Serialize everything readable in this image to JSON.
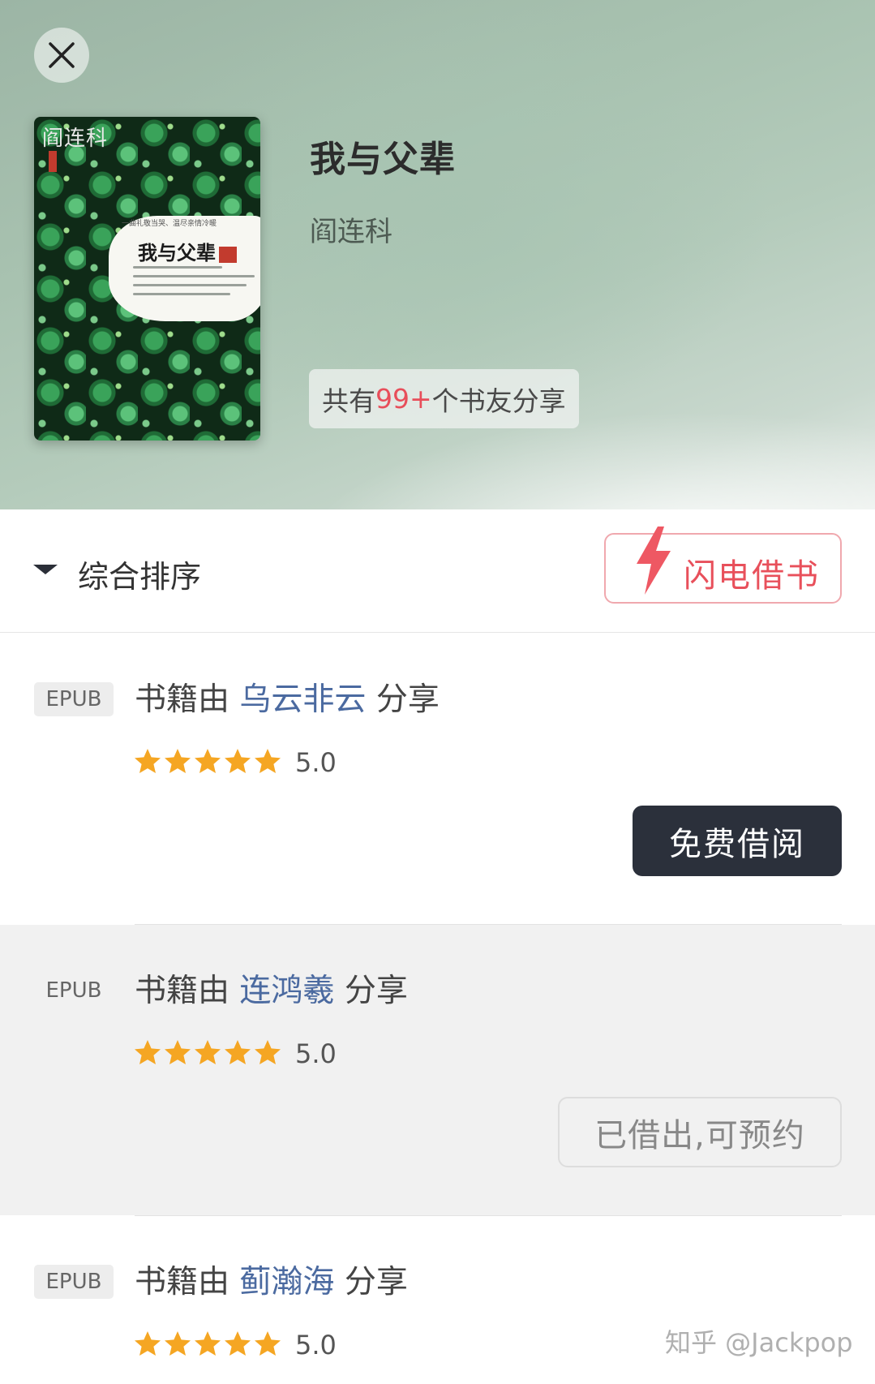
{
  "header": {
    "close_label": "×",
    "book_title": "我与父辈",
    "book_author": "阎连科",
    "share_prefix": "共有",
    "share_count": "99+",
    "share_suffix": "个书友分享"
  },
  "cover": {
    "author": "阎连科",
    "tagline": "一曲礼敬当哭、温尽亲情冷暖",
    "title": "我与父辈"
  },
  "sortbar": {
    "sort_label": "综合排序",
    "flash_label": "闪电借书"
  },
  "listings": [
    {
      "format": "EPUB",
      "prefix": "书籍由",
      "user": "乌云非云",
      "suffix": "分享",
      "rating": 5,
      "score": "5.0",
      "action": "免费借阅",
      "status": "available"
    },
    {
      "format": "EPUB",
      "prefix": "书籍由",
      "user": "连鸿羲",
      "suffix": "分享",
      "rating": 5,
      "score": "5.0",
      "action": "已借出,可预约",
      "status": "borrowed"
    },
    {
      "format": "EPUB",
      "prefix": "书籍由",
      "user": "蓟瀚海",
      "suffix": "分享",
      "rating": 5,
      "score": "5.0",
      "action": "",
      "status": "available"
    }
  ],
  "watermark": "知乎 @Jackpop",
  "colors": {
    "accent_red": "#e8505b",
    "user_link": "#4b6aa0",
    "star": "#f5a623",
    "dark_button": "#2b303b"
  }
}
